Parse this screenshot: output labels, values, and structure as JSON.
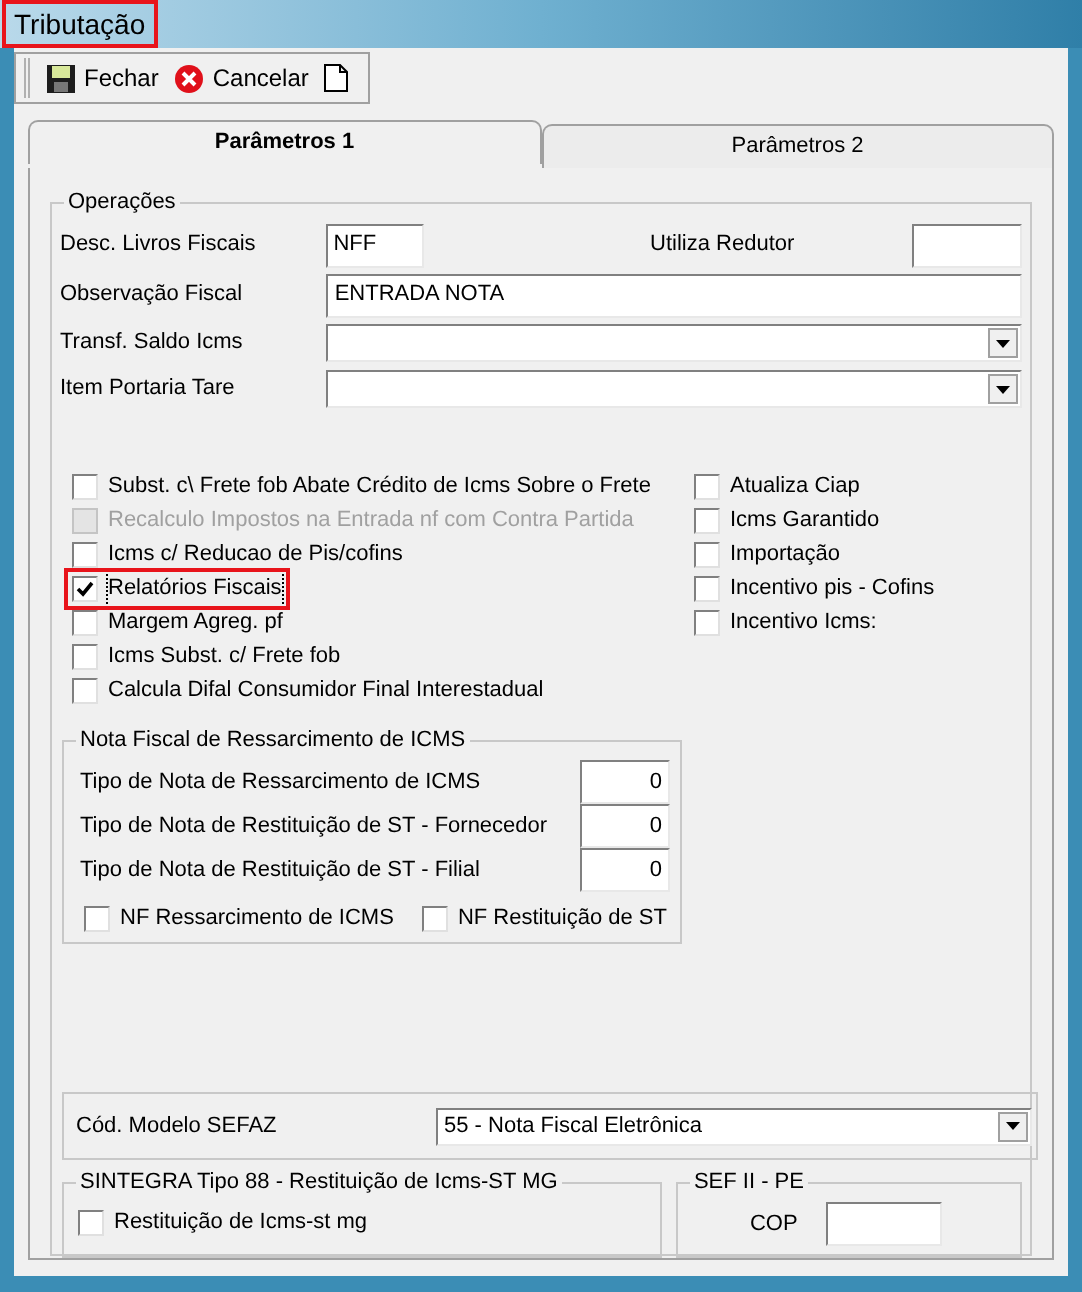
{
  "window": {
    "title": "Tributação",
    "highlighted": true
  },
  "toolbar": [
    {
      "kind": "save",
      "label": "Fechar"
    },
    {
      "kind": "cancel",
      "label": "Cancelar"
    },
    {
      "kind": "new"
    }
  ],
  "tabs": [
    {
      "label": "Parâmetros 1",
      "selected": true
    },
    {
      "label": "Parâmetros 2",
      "selected": false
    }
  ],
  "operacoes": {
    "title": "Operações",
    "desc_livros": {
      "label": "Desc. Livros Fiscais",
      "value": "NFF"
    },
    "utiliza_redutor": {
      "label": "Utiliza Redutor"
    },
    "observacao": {
      "label": "Observação Fiscal",
      "value": "ENTRADA NOTA"
    },
    "combos": [
      {
        "label": "Transf. Saldo Icms"
      },
      {
        "label": "Item Portaria Tare"
      }
    ],
    "checks_left": [
      {
        "label": "Subst. c\\ Frete fob Abate Crédito de Icms Sobre o Frete",
        "checked": false,
        "disabled": false,
        "highlighted": false
      },
      {
        "label": "Recalculo Impostos na Entrada nf com Contra Partida",
        "checked": false,
        "disabled": true,
        "highlighted": false
      },
      {
        "label": "Icms c/ Reducao de Pis/cofins",
        "checked": false,
        "disabled": false,
        "highlighted": false
      },
      {
        "label": "Relatórios Fiscais",
        "checked": true,
        "disabled": false,
        "highlighted": true
      },
      {
        "label": "Margem Agreg. pf",
        "checked": false,
        "disabled": false,
        "highlighted": false
      },
      {
        "label": "Icms Subst. c/ Frete fob",
        "checked": false,
        "disabled": false,
        "highlighted": false
      },
      {
        "label": "Calcula Difal Consumidor Final Interestadual",
        "checked": false,
        "disabled": false,
        "highlighted": false
      }
    ],
    "checks_right": [
      {
        "label": "Atualiza Ciap",
        "checked": false
      },
      {
        "label": "Icms Garantido",
        "checked": false
      },
      {
        "label": "Importação",
        "checked": false
      },
      {
        "label": "Incentivo pis - Cofins",
        "checked": false
      },
      {
        "label": "Incentivo Icms:",
        "checked": false
      }
    ]
  },
  "ressarcimento": {
    "title": "Nota Fiscal de Ressarcimento de ICMS",
    "fields": [
      {
        "label": "Tipo de Nota de Ressarcimento de ICMS",
        "value": "0"
      },
      {
        "label": "Tipo de Nota de Restituição de ST - Fornecedor",
        "value": "0"
      },
      {
        "label": "Tipo de Nota de Restituição de ST - Filial",
        "value": "0"
      }
    ],
    "checks": [
      {
        "label": "NF Ressarcimento de ICMS",
        "checked": false
      },
      {
        "label": "NF Restituição de ST",
        "checked": false
      }
    ]
  },
  "modelo_sefaz": {
    "label": "Cód. Modelo SEFAZ",
    "value": "55 - Nota Fiscal Eletrônica"
  },
  "sintegra": {
    "title": "SINTEGRA Tipo 88 - Restituição de Icms-ST MG",
    "check": {
      "label": "Restituição de  Icms-st mg",
      "checked": false
    }
  },
  "sef": {
    "title": "SEF II - PE",
    "field": {
      "label": "COP"
    }
  }
}
